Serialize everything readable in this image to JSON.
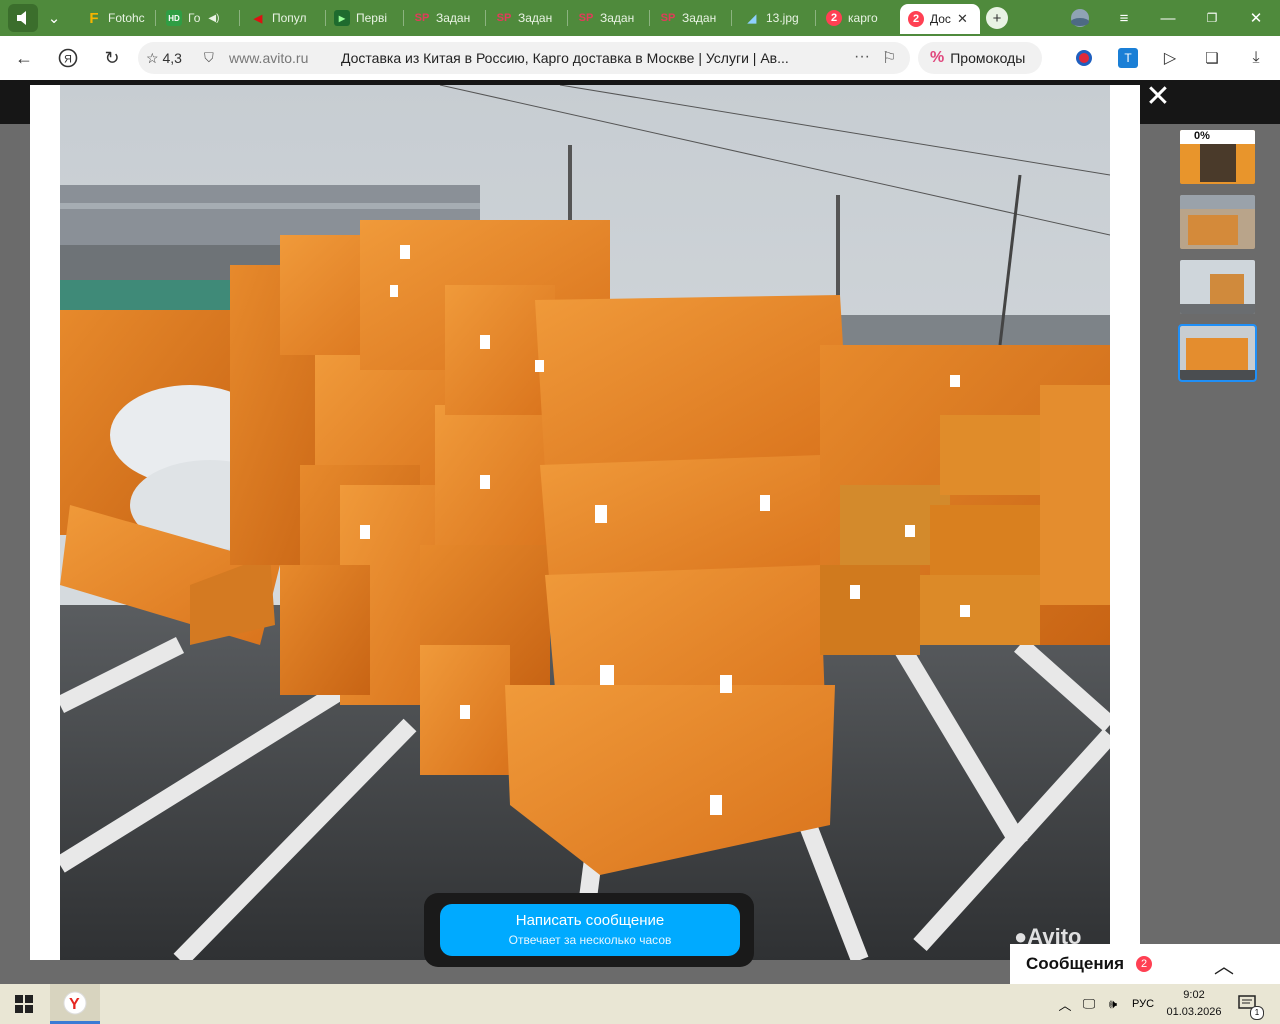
{
  "tabs": [
    {
      "label": "Fotohc",
      "icon": "F"
    },
    {
      "label": "Го",
      "icon": "HD"
    },
    {
      "label": "Попул",
      "icon": "yt"
    },
    {
      "label": "Перві",
      "icon": "vid"
    },
    {
      "label": "Задан",
      "icon": "SP"
    },
    {
      "label": "Задан",
      "icon": "SP"
    },
    {
      "label": "Задан",
      "icon": "SP"
    },
    {
      "label": "Задан",
      "icon": "SP"
    },
    {
      "label": "13.jpg",
      "icon": "img"
    },
    {
      "label": "карго",
      "icon": "2"
    },
    {
      "label": "Дос",
      "icon": "2",
      "active": true
    }
  ],
  "browser": {
    "rating": "4,3",
    "domain": "www.avito.ru",
    "page_title": "Доставка из Китая в Россию, Карго доставка в Москве | Услуги | Ав...",
    "promo_label": "Промокоды",
    "promo_icon": "%"
  },
  "gallery": {
    "watermark": "Avito",
    "close_label": "✕"
  },
  "thumbnails": [
    {
      "caption": "0%"
    },
    {
      "caption": ""
    },
    {
      "caption": ""
    },
    {
      "caption": ""
    }
  ],
  "message_button": {
    "title": "Написать сообщение",
    "subtitle": "Отвечает за несколько часов"
  },
  "messages_panel": {
    "label": "Сообщения",
    "count": "2"
  },
  "taskbar": {
    "language": "РУС",
    "time": "9:02",
    "date": "01.03.2026",
    "notification_count": "1"
  }
}
